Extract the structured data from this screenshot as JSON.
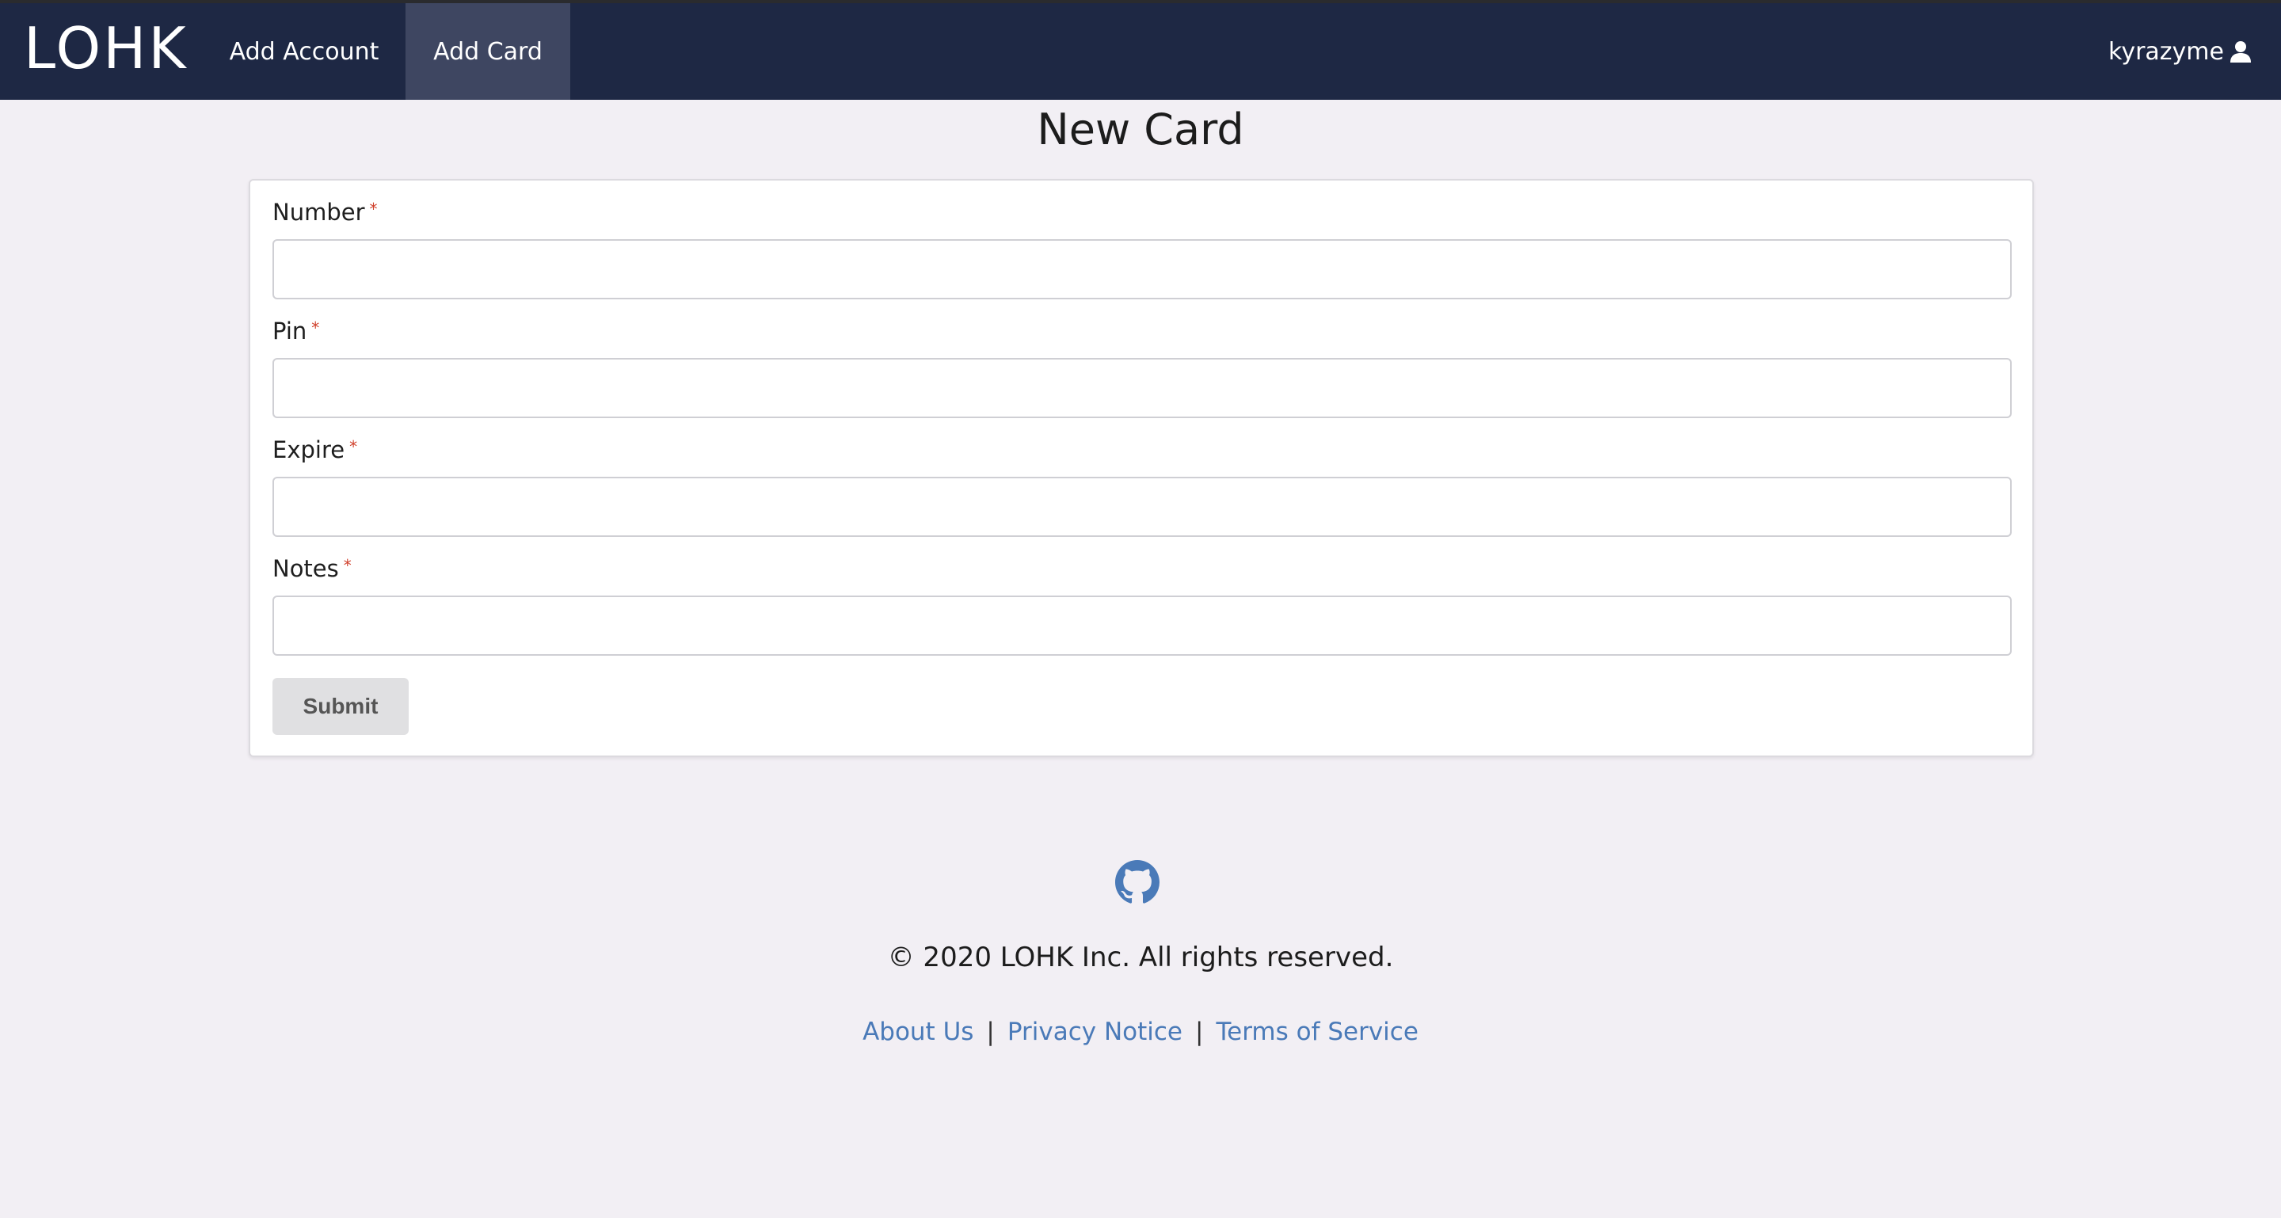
{
  "navbar": {
    "brand": "LOHK",
    "items": [
      {
        "label": "Add Account"
      },
      {
        "label": "Add Card"
      }
    ],
    "username": "kyrazyme",
    "user_icon": "user-icon"
  },
  "page": {
    "title": "New Card"
  },
  "form": {
    "fields": [
      {
        "label": "Number",
        "required_mark": "*",
        "value": ""
      },
      {
        "label": "Pin",
        "required_mark": "*",
        "value": ""
      },
      {
        "label": "Expire",
        "required_mark": "*",
        "value": ""
      },
      {
        "label": "Notes",
        "required_mark": "*",
        "value": ""
      }
    ],
    "submit_label": "Submit"
  },
  "footer": {
    "icon": "github-icon",
    "copyright": "© 2020 LOHK Inc. All rights reserved.",
    "links": [
      {
        "label": "About Us"
      },
      {
        "label": "Privacy Notice"
      },
      {
        "label": "Terms of Service"
      }
    ],
    "separator": "|"
  },
  "colors": {
    "navbar_bg": "#1e2844",
    "active_nav_bg": "#3e4661",
    "page_bg": "#f2eff4",
    "link": "#4a7ab8",
    "required": "#d0402b"
  }
}
